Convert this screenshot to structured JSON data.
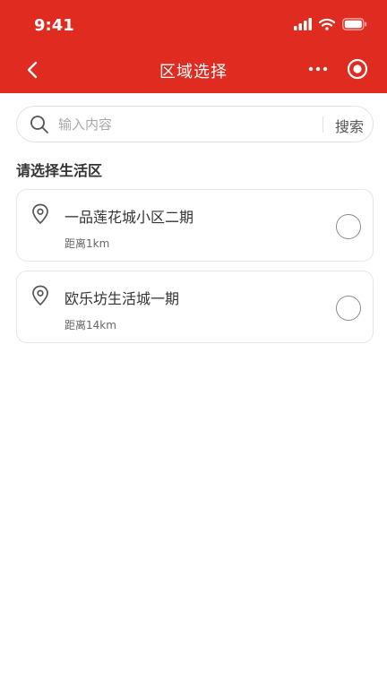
{
  "status_bar": {
    "time": "9:41"
  },
  "nav": {
    "title": "区域选择"
  },
  "search": {
    "placeholder": "输入内容",
    "button_label": "搜索"
  },
  "section_title": "请选择生活区",
  "communities": [
    {
      "name": "一品莲花城小区二期",
      "distance": "距离1km"
    },
    {
      "name": "欧乐坊生活城一期",
      "distance": "距离14km"
    }
  ],
  "colors": {
    "brand": "#e02b21",
    "card_border": "#e6e6e6",
    "radio_border": "#8a8a8a"
  },
  "icons": [
    "back-arrow-icon",
    "more-icon",
    "close-icon",
    "search-icon",
    "location-pin-icon",
    "signal-icon",
    "wifi-icon",
    "battery-icon"
  ]
}
